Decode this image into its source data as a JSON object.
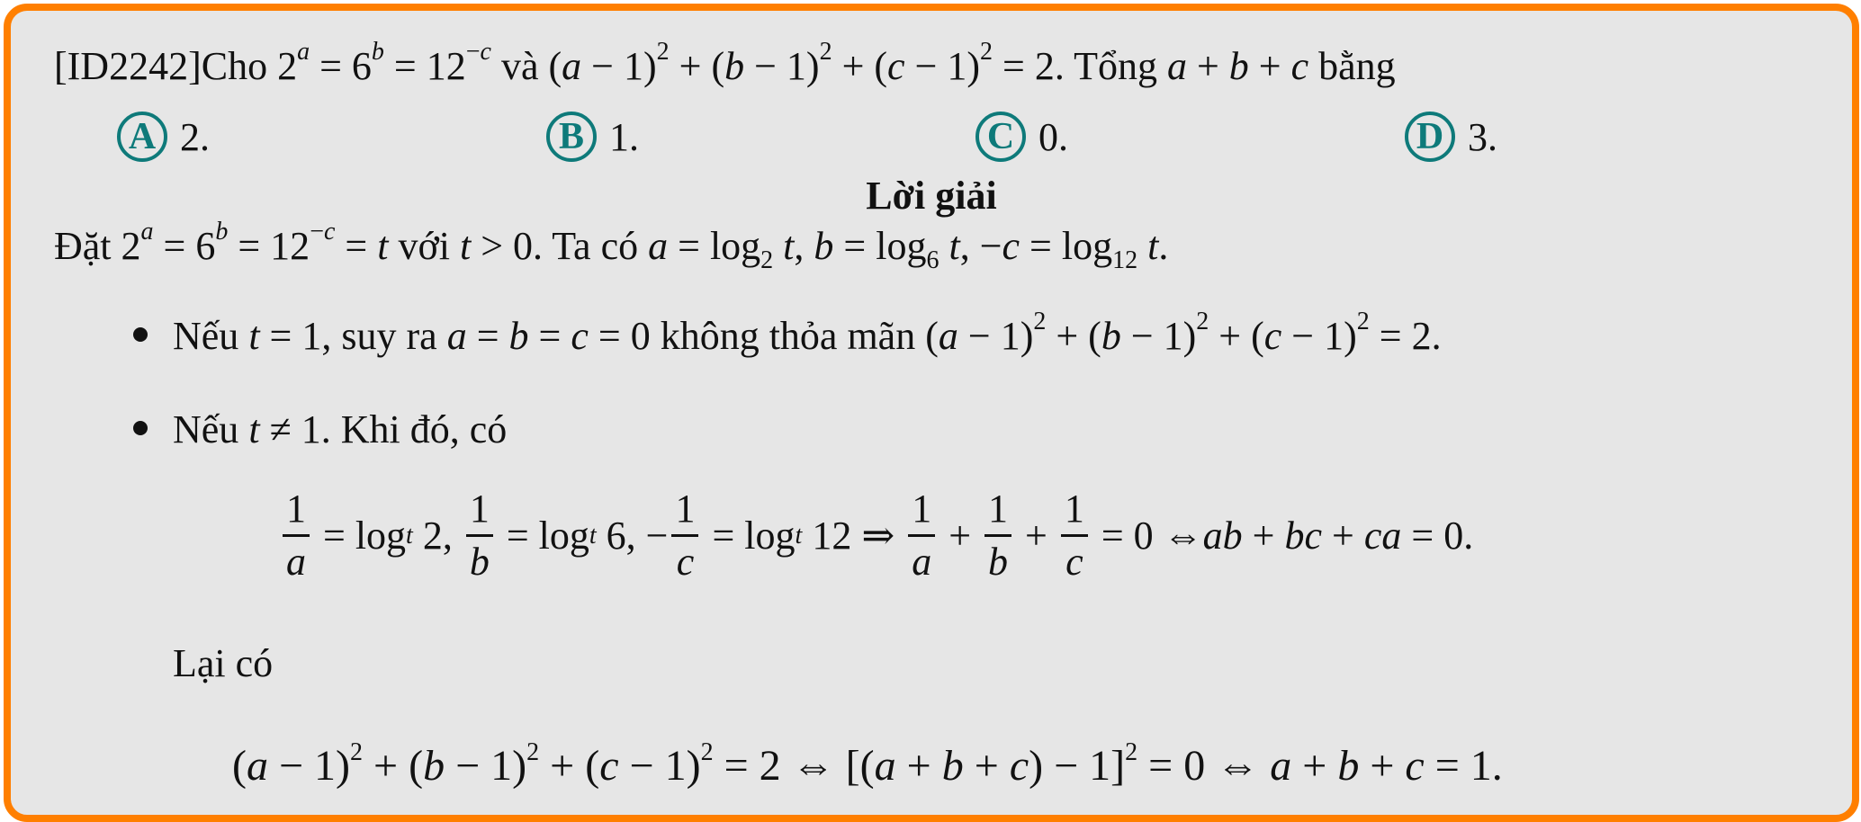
{
  "question": {
    "id": "[ID2242]",
    "word_cho": "Cho",
    "word_va": "và",
    "word_tong": "Tổng",
    "word_bang": "bằng"
  },
  "options": [
    {
      "letter": "A",
      "value": "2."
    },
    {
      "letter": "B",
      "value": "1."
    },
    {
      "letter": "C",
      "value": "0."
    },
    {
      "letter": "D",
      "value": "3."
    }
  ],
  "solution": {
    "heading": "Lời giải",
    "intro_dat": "Đặt",
    "intro_voi": "với",
    "intro_taco": "Ta có",
    "bullet1_neu": "Nếu",
    "bullet1_suyra": "suy ra",
    "bullet1_khong": "không thỏa mãn",
    "bullet2_neu": "Nếu",
    "bullet2_khido": "Khi đó, có",
    "lai_co": "Lại có"
  }
}
